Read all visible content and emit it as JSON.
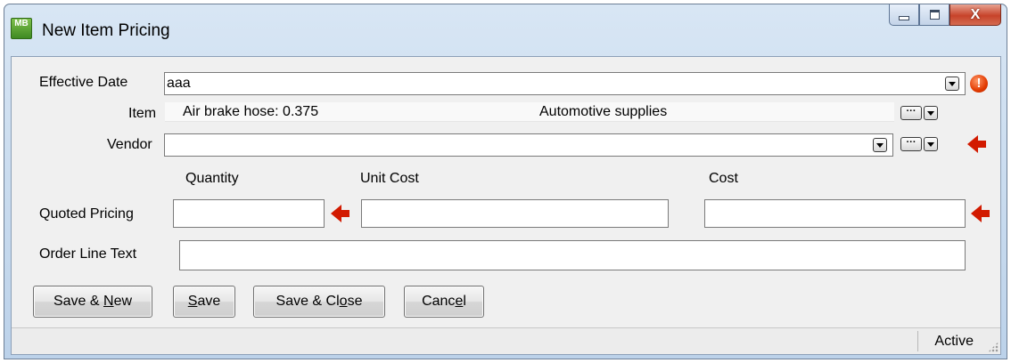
{
  "window": {
    "title": "New Item Pricing",
    "app_icon_text": "MB"
  },
  "form": {
    "effective_date_label": "Effective Date",
    "effective_date_value": "aaa",
    "item_label": "Item",
    "item_name": "Air brake hose: 0.375",
    "item_category": "Automotive supplies",
    "vendor_label": "Vendor",
    "vendor_value": "",
    "quantity_header": "Quantity",
    "unit_cost_header": "Unit Cost",
    "cost_header": "Cost",
    "quoted_pricing_label": "Quoted Pricing",
    "quantity_value": "",
    "unit_cost_value": "",
    "cost_value": "",
    "order_line_text_label": "Order Line Text",
    "order_line_text_value": ""
  },
  "buttons": {
    "save_new_pre": "Save & ",
    "save_new_key": "N",
    "save_new_post": "ew",
    "save_key": "S",
    "save_post": "ave",
    "save_close_pre": "Save & Cl",
    "save_close_key": "o",
    "save_close_post": "se",
    "cancel_pre": "Canc",
    "cancel_key": "e",
    "cancel_post": "l"
  },
  "status": {
    "state": "Active"
  },
  "colors": {
    "required_arrow": "#d21a00",
    "warning_icon": "#e23a00"
  },
  "icons": [
    "app-icon",
    "minimize-icon",
    "maximize-icon",
    "close-icon",
    "chevron-down-icon",
    "ellipsis-icon",
    "required-arrow-icon",
    "warning-icon",
    "resize-grip-icon"
  ]
}
